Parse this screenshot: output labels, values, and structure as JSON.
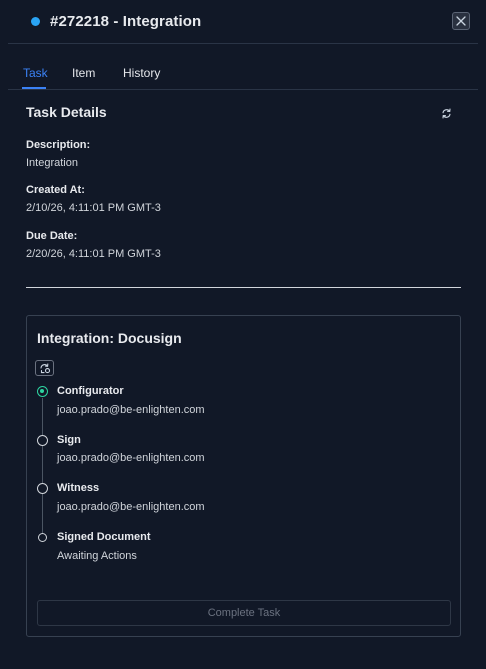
{
  "header": {
    "title": "#272218 - Integration",
    "status_color": "#2aa4f4",
    "close_icon": "close-icon"
  },
  "tabs": [
    {
      "label": "Task",
      "active": true
    },
    {
      "label": "Item",
      "active": false
    },
    {
      "label": "History",
      "active": false
    }
  ],
  "details": {
    "title": "Task Details",
    "refresh_icon": "refresh-icon",
    "fields": [
      {
        "label": "Description:",
        "value": "Integration"
      },
      {
        "label": "Created At:",
        "value": "2/10/26, 4:11:01 PM GMT-3"
      },
      {
        "label": "Due Date:",
        "value": "2/20/26, 4:11:01 PM GMT-3"
      }
    ]
  },
  "integration": {
    "title": "Integration: Docusign",
    "sync_icon": "sync-icon",
    "steps": [
      {
        "title": "Configurator",
        "subtitle": "joao.prado@be-enlighten.com",
        "status": "active"
      },
      {
        "title": "Sign",
        "subtitle": "joao.prado@be-enlighten.com",
        "status": "pending"
      },
      {
        "title": "Witness",
        "subtitle": "joao.prado@be-enlighten.com",
        "status": "pending"
      },
      {
        "title": "Signed Document",
        "subtitle": "Awaiting Actions",
        "status": "pending"
      }
    ],
    "complete_label": "Complete Task"
  },
  "colors": {
    "background": "#111827",
    "accent": "#3b82f6",
    "active_step": "#2dd4a0"
  }
}
